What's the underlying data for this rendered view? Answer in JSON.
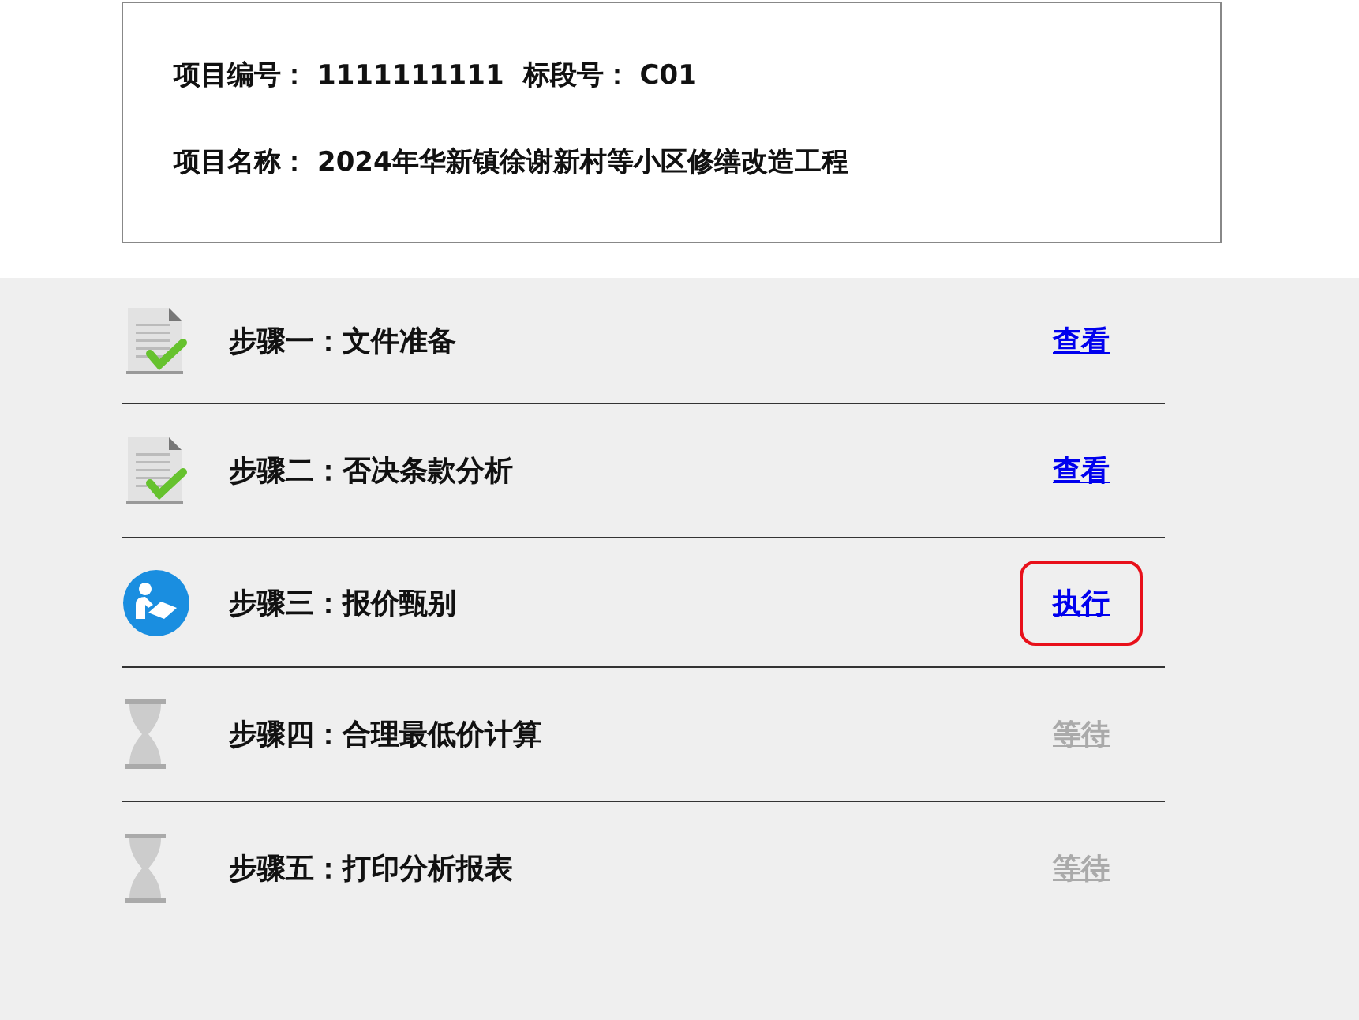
{
  "project": {
    "fields": [
      {
        "label": "项目编号：",
        "value": "1111111111"
      },
      {
        "label": "标段号：",
        "value": "C01"
      }
    ],
    "name": {
      "label": "项目名称：",
      "value": "2024年华新镇徐谢新村等小区修缮改造工程"
    }
  },
  "steps": [
    {
      "title": "步骤一：文件准备",
      "action": "查看",
      "kind": "done",
      "selected": false
    },
    {
      "title": "步骤二：否决条款分析",
      "action": "查看",
      "kind": "done",
      "selected": false
    },
    {
      "title": "步骤三：报价甄别",
      "action": "执行",
      "kind": "current",
      "selected": true
    },
    {
      "title": "步骤四：合理最低价计算",
      "action": "等待",
      "kind": "waiting",
      "selected": false
    },
    {
      "title": "步骤五：打印分析报表",
      "action": "等待",
      "kind": "waiting",
      "selected": false
    }
  ]
}
